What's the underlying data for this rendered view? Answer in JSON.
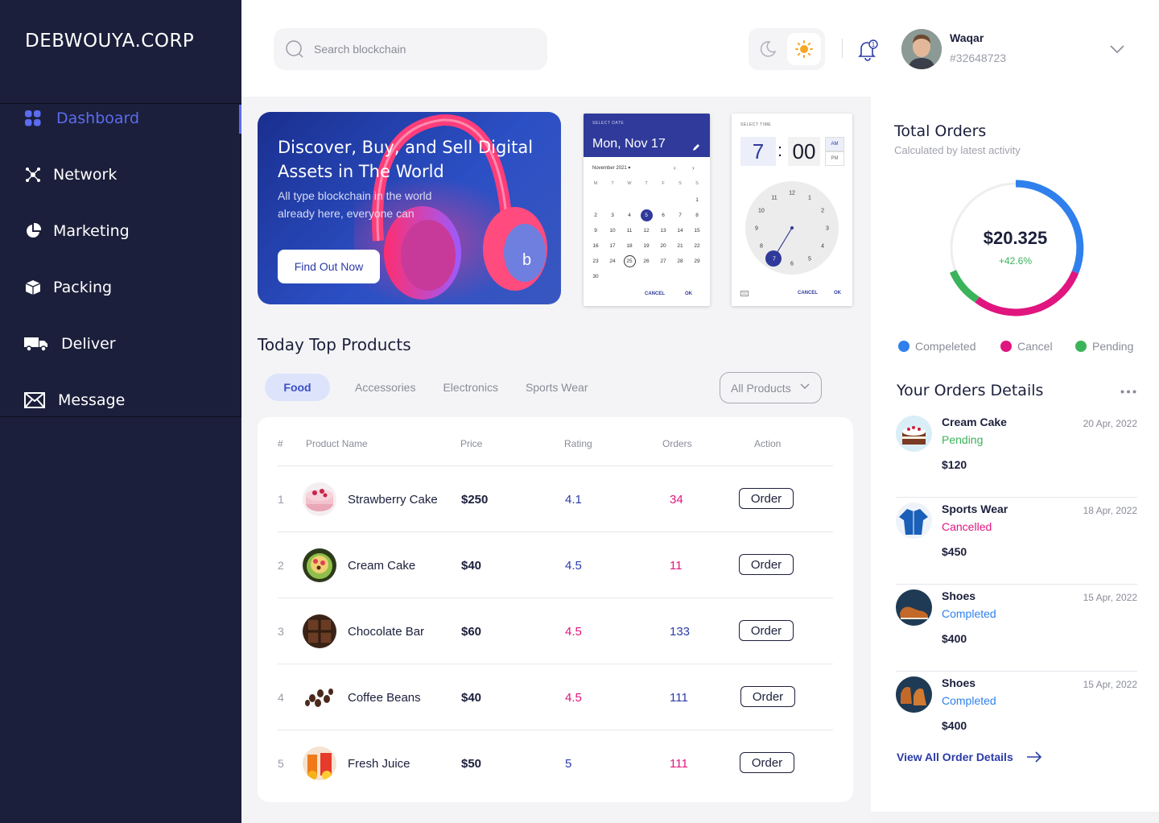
{
  "brand": "DEBWOUYA.CORP",
  "nav": [
    {
      "label": "Dashboard",
      "icon": "grid-icon",
      "active": true
    },
    {
      "label": "Network",
      "icon": "network-icon"
    },
    {
      "label": "Marketing",
      "icon": "pie-chart-icon"
    },
    {
      "label": "Packing",
      "icon": "box-icon"
    },
    {
      "label": "Deliver",
      "icon": "truck-icon"
    },
    {
      "label": "Message",
      "icon": "mail-icon"
    }
  ],
  "header": {
    "search_placeholder": "Search blockchain",
    "notification_count": "1",
    "user": {
      "name": "Waqar",
      "id": "#32648723"
    }
  },
  "banner": {
    "title": "Discover, Buy, and Sell Digital Assets in The World",
    "text": "All type blockchain in the world already here, everyone can",
    "button": "Find Out Now"
  },
  "date_picker": {
    "label": "SELECT DATE",
    "date": "Mon, Nov 17",
    "month": "November 2021",
    "weekdays": [
      "M",
      "T",
      "W",
      "T",
      "F",
      "S",
      "S"
    ],
    "cancel": "CANCEL",
    "ok": "OK"
  },
  "time_picker": {
    "label": "SELECT TIME",
    "hour": "7",
    "minute": "00",
    "am": "AM",
    "pm": "PM",
    "cancel": "CANCEL",
    "ok": "OK"
  },
  "products": {
    "title": "Today Top Products",
    "tabs": [
      "Food",
      "Accessories",
      "Electronics",
      "Sports Wear"
    ],
    "filter": "All Products",
    "columns": [
      "#",
      "Product Name",
      "Price",
      "Rating",
      "Orders",
      "Action"
    ],
    "rows": [
      {
        "n": "1",
        "name": "Strawberry Cake",
        "price": "$250",
        "rating": "4.1",
        "orders": "34",
        "action": "Order"
      },
      {
        "n": "2",
        "name": "Cream Cake",
        "price": "$40",
        "rating": "4.5",
        "orders": "11",
        "action": "Order"
      },
      {
        "n": "3",
        "name": "Chocolate Bar",
        "price": "$60",
        "rating": "4.5",
        "orders": "133",
        "action": "Order"
      },
      {
        "n": "4",
        "name": "Coffee Beans",
        "price": "$40",
        "rating": "4.5",
        "orders": "111",
        "action": "Order"
      },
      {
        "n": "5",
        "name": "Fresh Juice",
        "price": "$50",
        "rating": "5",
        "orders": "111",
        "action": "Order"
      }
    ]
  },
  "total_orders": {
    "title": "Total Orders",
    "subtitle": "Calculated by latest activity",
    "value": "$20.325",
    "change": "+42.6%",
    "legend": [
      {
        "label": "Compeleted",
        "color": "#2f80ed"
      },
      {
        "label": "Cancel",
        "color": "#e0157f"
      },
      {
        "label": "Pending",
        "color": "#3bb35a"
      }
    ]
  },
  "order_details": {
    "title": "Your Orders Details",
    "items": [
      {
        "name": "Cream Cake",
        "status": "Pending",
        "price": "$120",
        "date": "20 Apr, 2022"
      },
      {
        "name": "Sports Wear",
        "status": "Cancelled",
        "price": "$450",
        "date": "18 Apr, 2022"
      },
      {
        "name": "Shoes",
        "status": "Completed",
        "price": "$400",
        "date": "15 Apr, 2022"
      },
      {
        "name": "Shoes",
        "status": "Completed",
        "price": "$400",
        "date": "15 Apr, 2022"
      }
    ],
    "view_all": "View All Order Details"
  }
}
